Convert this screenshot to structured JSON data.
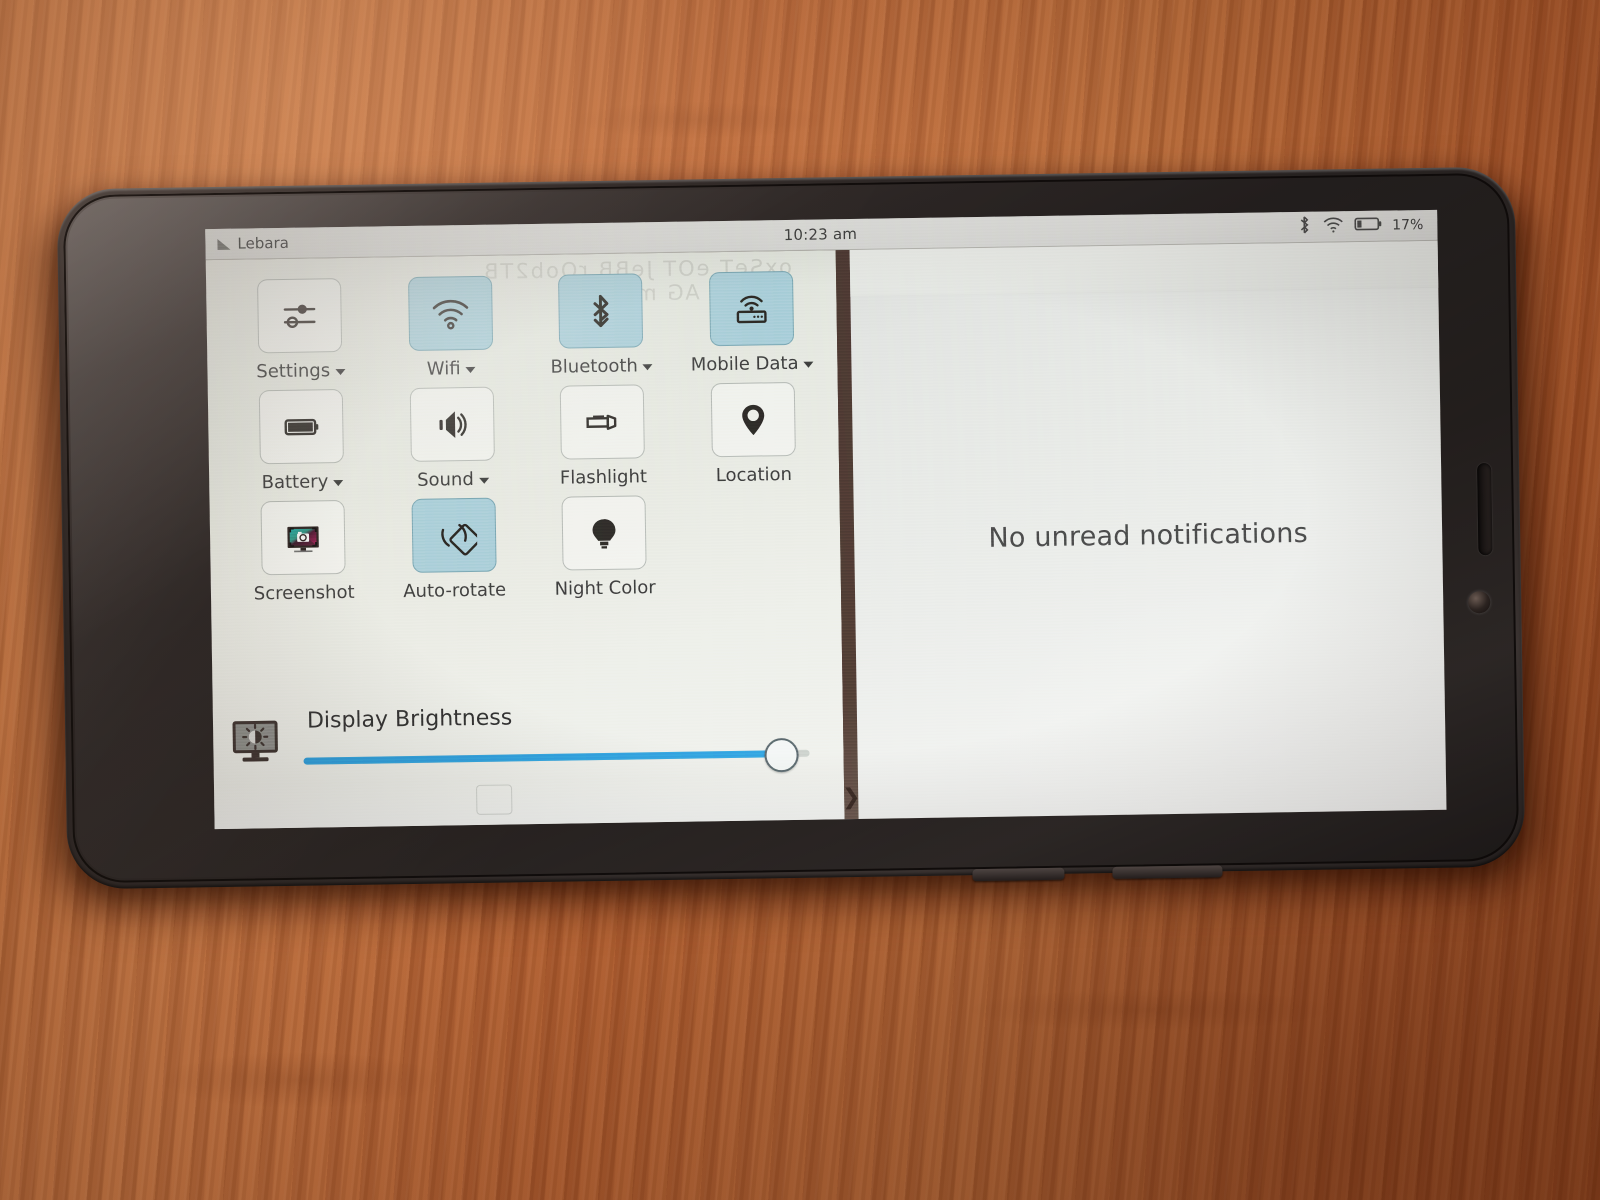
{
  "status_bar": {
    "carrier": "Lebara",
    "signal_icon": "signal-triangle-icon",
    "clock": "10:23 am",
    "bluetooth_icon": "bluetooth-icon",
    "wifi_icon": "wifi-icon",
    "battery_icon": "battery-low-icon",
    "battery_percent": "17%"
  },
  "quick_settings": {
    "tiles": [
      {
        "label": "Settings",
        "icon": "sliders-icon",
        "active": false,
        "has_menu": true
      },
      {
        "label": "Wifi",
        "icon": "wifi-icon",
        "active": true,
        "has_menu": true
      },
      {
        "label": "Bluetooth",
        "icon": "bluetooth-icon",
        "active": true,
        "has_menu": true
      },
      {
        "label": "Mobile Data",
        "icon": "router-icon",
        "active": true,
        "has_menu": true
      },
      {
        "label": "Battery",
        "icon": "battery-icon",
        "active": false,
        "has_menu": true
      },
      {
        "label": "Sound",
        "icon": "speaker-icon",
        "active": false,
        "has_menu": true
      },
      {
        "label": "Flashlight",
        "icon": "flashlight-icon",
        "active": false,
        "has_menu": false
      },
      {
        "label": "Location",
        "icon": "map-pin-icon",
        "active": false,
        "has_menu": false
      },
      {
        "label": "Screenshot",
        "icon": "screenshot-icon",
        "active": false,
        "has_menu": false
      },
      {
        "label": "Auto-rotate",
        "icon": "auto-rotate-icon",
        "active": true,
        "has_menu": false
      },
      {
        "label": "Night Color",
        "icon": "lightbulb-icon",
        "active": false,
        "has_menu": false
      }
    ]
  },
  "brightness": {
    "title": "Display Brightness",
    "icon": "display-brightness-icon",
    "value_percent": 94
  },
  "notifications": {
    "empty_message": "No unread notifications"
  },
  "divider": {
    "expand_icon": "chevron-right-icon"
  },
  "ghost_burn_in": {
    "line1": "oxSeT eOT JeBB  rOob2TB",
    "line2": "uSeT e   AG        moT"
  },
  "colors": {
    "tile_active": "#a9cfda",
    "tile_inactive": "rgba(255,255,255,0.40)",
    "slider_fill": "#2b9ede",
    "text": "#3c3c3c",
    "panel_bg": "#e8eae3"
  }
}
